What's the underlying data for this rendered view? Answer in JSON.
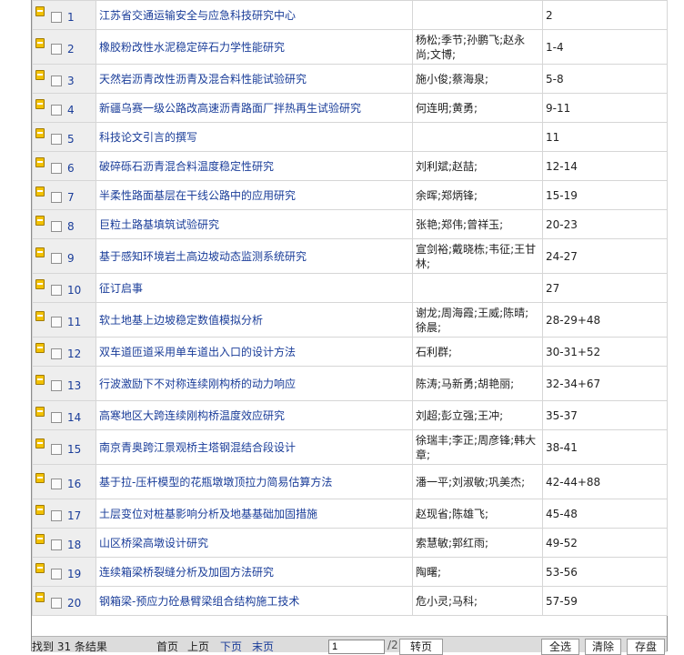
{
  "results": [
    {
      "index": "1",
      "title": "江苏省交通运输安全与应急科技研究中心",
      "authors": "",
      "pages": "2"
    },
    {
      "index": "2",
      "title": "橡胶粉改性水泥稳定碎石力学性能研究",
      "authors": "杨松;季节;孙鹏飞;赵永尚;文博;",
      "pages": "1-4"
    },
    {
      "index": "3",
      "title": "天然岩沥青改性沥青及混合料性能试验研究",
      "authors": "施小俊;蔡海泉;",
      "pages": "5-8"
    },
    {
      "index": "4",
      "title": "新疆乌赛一级公路改高速沥青路面厂拌热再生试验研究",
      "authors": "何连明;黄勇;",
      "pages": "9-11"
    },
    {
      "index": "5",
      "title": "科技论文引言的撰写",
      "authors": "",
      "pages": "11"
    },
    {
      "index": "6",
      "title": "破碎砾石沥青混合料温度稳定性研究",
      "authors": "刘利斌;赵喆;",
      "pages": "12-14"
    },
    {
      "index": "7",
      "title": "半柔性路面基层在干线公路中的应用研究",
      "authors": "余晖;郑炳锋;",
      "pages": "15-19"
    },
    {
      "index": "8",
      "title": "巨粒土路基填筑试验研究",
      "authors": "张艳;郑伟;曾祥玉;",
      "pages": "20-23"
    },
    {
      "index": "9",
      "title": "基于感知环境岩土高边坡动态监测系统研究",
      "authors": "宣剑裕;戴晓栋;韦征;王甘林;",
      "pages": "24-27"
    },
    {
      "index": "10",
      "title": "征订启事",
      "authors": "",
      "pages": "27"
    },
    {
      "index": "11",
      "title": "软土地基上边坡稳定数值模拟分析",
      "authors": "谢龙;周海霞;王威;陈晴;徐晨;",
      "pages": "28-29+48"
    },
    {
      "index": "12",
      "title": "双车道匝道采用单车道出入口的设计方法",
      "authors": "石利群;",
      "pages": "30-31+52"
    },
    {
      "index": "13",
      "title": "行波激励下不对称连续刚构桥的动力响应",
      "authors": "陈涛;马新勇;胡艳丽;",
      "pages": "32-34+67"
    },
    {
      "index": "14",
      "title": "高寒地区大跨连续刚构桥温度效应研究",
      "authors": "刘超;彭立强;王冲;",
      "pages": "35-37"
    },
    {
      "index": "15",
      "title": "南京青奥跨江景观桥主塔钢混结合段设计",
      "authors": "徐瑞丰;李正;周彦锋;韩大章;",
      "pages": "38-41"
    },
    {
      "index": "16",
      "title": "基于拉-压杆模型的花瓶墩墩顶拉力简易估算方法",
      "authors": "潘一平;刘淑敏;巩美杰;",
      "pages": "42-44+88"
    },
    {
      "index": "17",
      "title": "土层变位对桩基影响分析及地基基础加固措施",
      "authors": "赵现省;陈雄飞;",
      "pages": "45-48"
    },
    {
      "index": "18",
      "title": "山区桥梁高墩设计研究",
      "authors": "索慧敏;郭红雨;",
      "pages": "49-52"
    },
    {
      "index": "19",
      "title": "连续箱梁桥裂缝分析及加固方法研究",
      "authors": "陶曙;",
      "pages": "53-56"
    },
    {
      "index": "20",
      "title": "钢箱梁-预应力砼悬臂梁组合结构施工技术",
      "authors": "危小灵;马科;",
      "pages": "57-59"
    }
  ],
  "pager": {
    "result_count": "找到 31 条结果",
    "first": "首页",
    "prev": "上页",
    "next": "下页",
    "last": "末页",
    "page_value": "1",
    "page_total": "/2",
    "go": "转页",
    "select_all": "全选",
    "clear": "清除",
    "save": "存盘"
  }
}
